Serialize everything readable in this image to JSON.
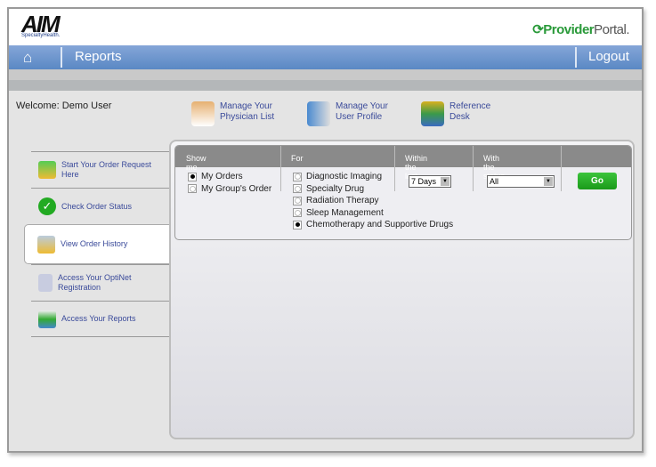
{
  "header": {
    "logo_main": "AIM",
    "logo_sub": "SpecialtyHealth.",
    "portal_a": "Provider",
    "portal_b": "Portal."
  },
  "nav": {
    "home_icon": "home-icon",
    "title": "Reports",
    "logout": "Logout"
  },
  "welcome": "Welcome: Demo User",
  "quick_links": [
    {
      "l1": "Manage Your",
      "l2": "Physician List",
      "icon": "physician-icon"
    },
    {
      "l1": "Manage Your",
      "l2": "User Profile",
      "icon": "id-card-icon"
    },
    {
      "l1": "Reference",
      "l2": "Desk",
      "icon": "books-icon"
    }
  ],
  "sidebar": [
    {
      "label": "Start Your Order Request Here",
      "icon": "download-tray-icon"
    },
    {
      "label": "Check Order Status",
      "icon": "check-circle-icon"
    },
    {
      "label": "View Order History",
      "icon": "history-icon",
      "active": true
    },
    {
      "label": "Access Your OptiNet Registration",
      "icon": "document-icon"
    },
    {
      "label": "Access Your Reports",
      "icon": "chart-icon"
    }
  ],
  "filter": {
    "headers": [
      "Show me",
      "For",
      "Within the last",
      "With the status"
    ],
    "show_me": [
      {
        "label": "My Orders",
        "selected": true
      },
      {
        "label": "My Group's Order",
        "selected": false
      }
    ],
    "for": [
      {
        "label": "Diagnostic Imaging",
        "selected": false
      },
      {
        "label": "Specialty Drug",
        "selected": false
      },
      {
        "label": "Radiation Therapy",
        "selected": false
      },
      {
        "label": "Sleep Management",
        "selected": false
      },
      {
        "label": "Chemotherapy and Supportive Drugs",
        "selected": true
      }
    ],
    "within": "7 Days",
    "status": "All",
    "go": "Go"
  },
  "colors": {
    "nav": "#5a88c4",
    "go": "#2aaa2a",
    "link": "#3a4a9a"
  }
}
